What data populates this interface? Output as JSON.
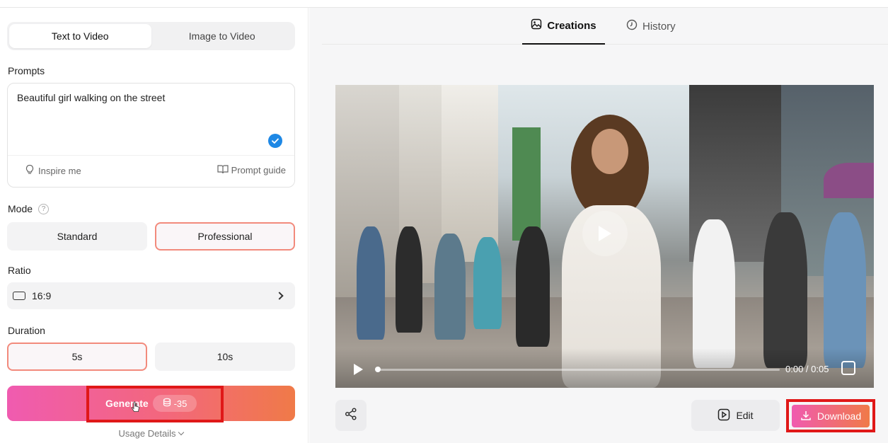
{
  "left_panel": {
    "mode_tabs": [
      "Text to Video",
      "Image to Video"
    ],
    "active_mode_tab": "Text to Video",
    "prompts_label": "Prompts",
    "prompt_text": "Beautiful girl walking on the street",
    "inspire_label": "Inspire me",
    "guide_label": "Prompt guide",
    "mode_label": "Mode",
    "mode_options": [
      "Standard",
      "Professional"
    ],
    "selected_mode": "Professional",
    "ratio_label": "Ratio",
    "ratio_value": "16:9",
    "duration_label": "Duration",
    "duration_options": [
      "5s",
      "10s"
    ],
    "selected_duration": "5s",
    "generate_label": "Generate",
    "generate_cost": "-35",
    "usage_label": "Usage Details"
  },
  "right_panel": {
    "tabs": [
      "Creations",
      "History"
    ],
    "active_tab": "Creations",
    "video": {
      "time": "0:00 / 0:05",
      "progress": 0.0
    },
    "edit_label": "Edit",
    "download_label": "Download"
  },
  "colors": {
    "accent_gradient_start": "#f05bb0",
    "accent_gradient_end": "#f07a48",
    "highlight_red": "#e01818",
    "check_blue": "#1e88e5"
  }
}
